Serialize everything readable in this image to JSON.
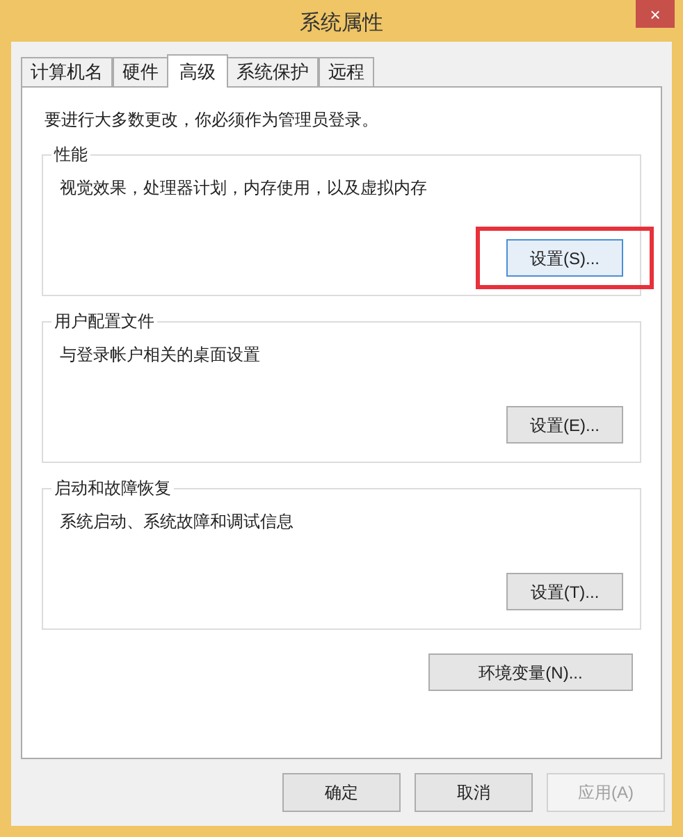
{
  "window": {
    "title": "系统属性",
    "close": "×"
  },
  "tabs": [
    {
      "label": "计算机名",
      "selected": false
    },
    {
      "label": "硬件",
      "selected": false
    },
    {
      "label": "高级",
      "selected": true
    },
    {
      "label": "系统保护",
      "selected": false
    },
    {
      "label": "远程",
      "selected": false
    }
  ],
  "notice": "要进行大多数更改，你必须作为管理员登录。",
  "groups": [
    {
      "title": "性能",
      "description": "视觉效果，处理器计划，内存使用，以及虚拟内存",
      "button": "设置(S)...",
      "highlighted": true
    },
    {
      "title": "用户配置文件",
      "description": "与登录帐户相关的桌面设置",
      "button": "设置(E)...",
      "highlighted": false
    },
    {
      "title": "启动和故障恢复",
      "description": "系统启动、系统故障和调试信息",
      "button": "设置(T)...",
      "highlighted": false
    }
  ],
  "env_button": "环境变量(N)...",
  "buttons": [
    {
      "label": "确定",
      "disabled": false
    },
    {
      "label": "取消",
      "disabled": false
    },
    {
      "label": "应用(A)",
      "disabled": true
    }
  ]
}
